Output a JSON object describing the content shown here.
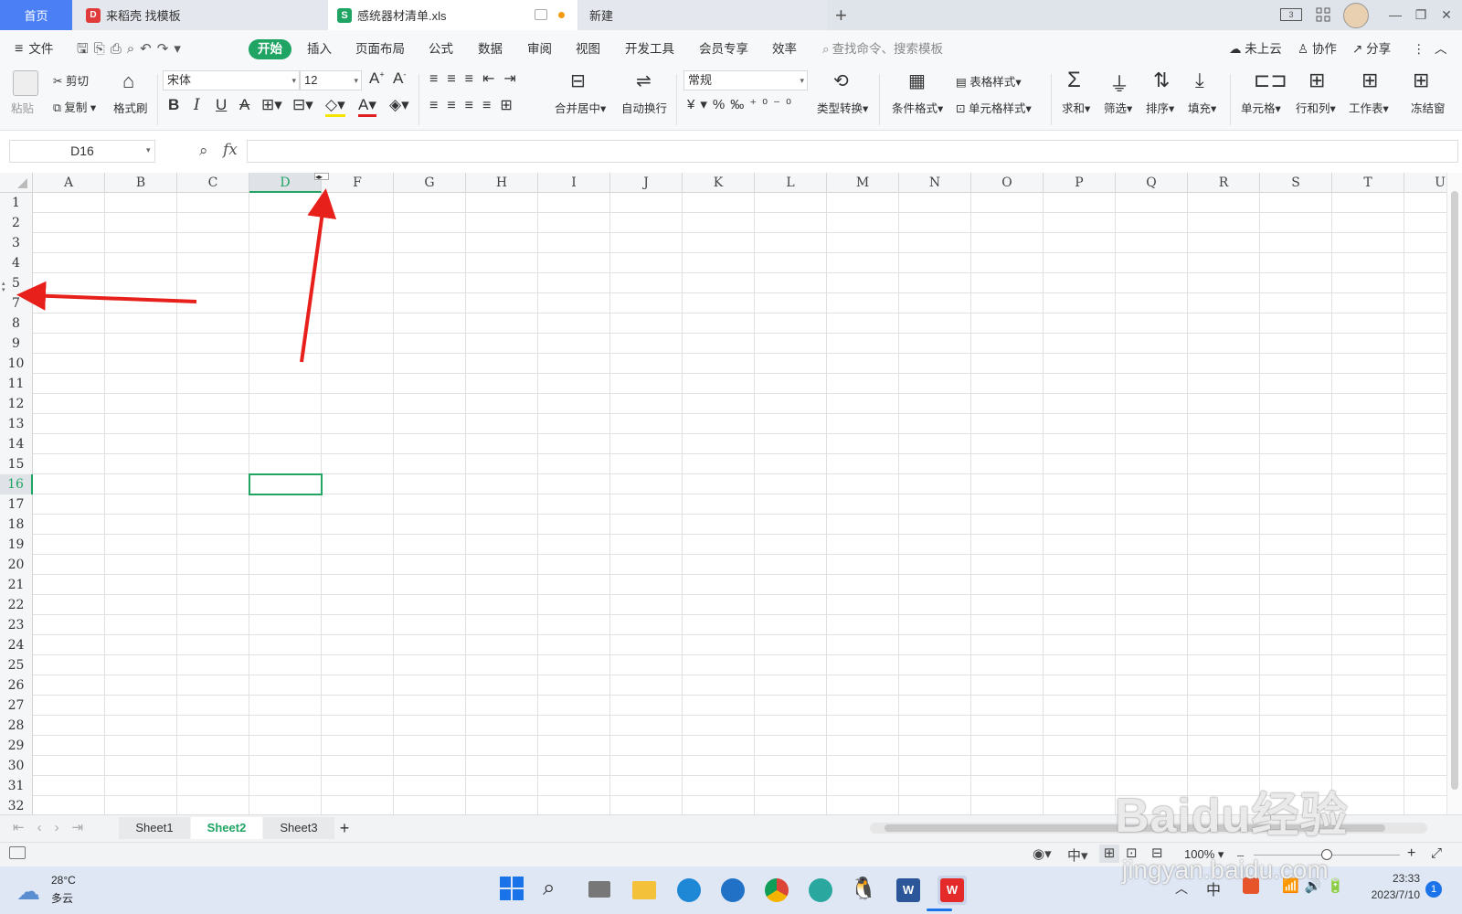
{
  "tabs": {
    "home": "首页",
    "template": "来稻壳 找模板",
    "file": "感统器材清单.xls",
    "new": "新建"
  },
  "menu": {
    "file": "文件",
    "items": [
      "开始",
      "插入",
      "页面布局",
      "公式",
      "数据",
      "审阅",
      "视图",
      "开发工具",
      "会员专享",
      "效率"
    ],
    "search_placeholder": "查找命令、搜索模板",
    "cloud": "未上云",
    "collab": "协作",
    "share": "分享"
  },
  "ribbon": {
    "paste": "粘贴",
    "cut": "剪切",
    "copy": "复制",
    "format_painter": "格式刷",
    "font_name": "宋体",
    "font_size": "12",
    "merge_center": "合并居中",
    "wrap": "自动换行",
    "number_format": "常规",
    "type_convert": "类型转换",
    "cond_format": "条件格式",
    "table_style": "表格样式",
    "cell_style": "单元格样式",
    "sum": "求和",
    "filter": "筛选",
    "sort": "排序",
    "fill": "填充",
    "cell": "单元格",
    "rowcol": "行和列",
    "worksheet": "工作表",
    "freeze": "冻结窗"
  },
  "formula": {
    "name_box": "D16",
    "fx": "fx"
  },
  "columns": [
    "A",
    "B",
    "C",
    "D",
    "F",
    "G",
    "H",
    "I",
    "J",
    "K",
    "L",
    "M",
    "N",
    "O",
    "P",
    "Q",
    "R",
    "S",
    "T",
    "U"
  ],
  "rows": [
    "1",
    "2",
    "3",
    "4",
    "5",
    "7",
    "8",
    "9",
    "10",
    "11",
    "12",
    "13",
    "14",
    "15",
    "16",
    "17",
    "18",
    "19",
    "20",
    "21",
    "22",
    "23",
    "24",
    "25",
    "26",
    "27",
    "28",
    "29",
    "30",
    "31",
    "32"
  ],
  "selected_cell": "D16",
  "sheets": [
    "Sheet1",
    "Sheet2",
    "Sheet3"
  ],
  "active_sheet": "Sheet2",
  "status": {
    "zoom": "100%"
  },
  "taskbar": {
    "temp": "28°C",
    "weather": "多云",
    "ime": "中",
    "time": "23:33",
    "date": "2023/7/10",
    "notif": "1"
  },
  "watermark": {
    "main": "Baidu经验",
    "sub": "jingyan.baidu.com"
  },
  "colors": {
    "accent": "#1fa463",
    "home_tab": "#4a7ff6",
    "arrow": "#e8201c"
  }
}
